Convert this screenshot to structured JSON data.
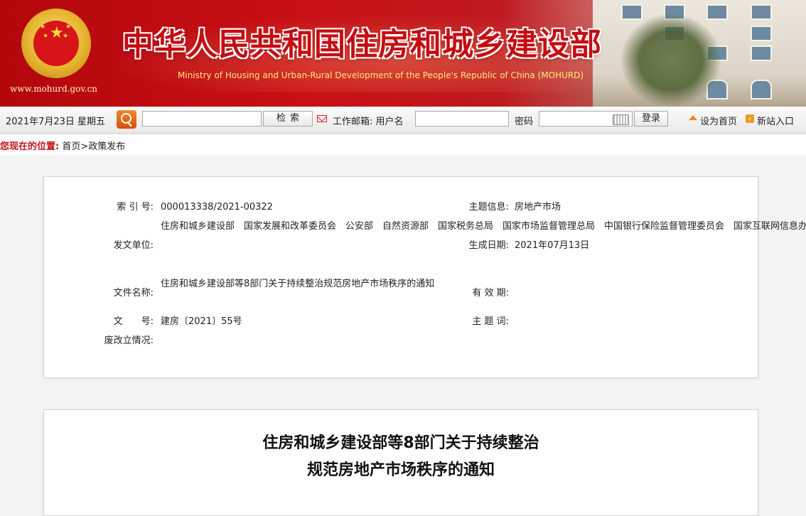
{
  "banner": {
    "site_url": "www.mohurd.gov.cn",
    "title_cn": "中华人民共和国住房和城乡建设部",
    "title_en": "Ministry of Housing and Urban-Rural Development of the People's Republic of China (MOHURD)"
  },
  "toolbar": {
    "date": "2021年7月23日 星期五",
    "search_value": "",
    "search_button": "检索",
    "mail_label": "工作邮箱: 用户名",
    "username_value": "",
    "password_label": "密码",
    "password_value": "",
    "login_button": "登录",
    "set_home": "设为首页",
    "new_site": "新站入口"
  },
  "breadcrumb": {
    "label": "您现在的位置:",
    "path": "首页>政策发布"
  },
  "info": {
    "index_label": "索 引 号:",
    "index_value": "000013338/2021-00322",
    "topic_label": "主题信息:",
    "topic_value": "房地产市场",
    "issuer_label": "发文单位:",
    "issuer_value": "住房和城乡建设部　国家发展和改革委员会　公安部　自然资源部　国家税务总局　国家市场监督管理总局　中国银行保险监督管理委员会　国家互联网信息办公室",
    "date_label": "生成日期:",
    "date_value": "2021年07月13日",
    "filename_label": "文件名称:",
    "filename_value": "住房和城乡建设部等8部门关于持续整治规范房地产市场秩序的通知",
    "valid_label": "有 效 期:",
    "valid_value": "",
    "docno_label": "文　　号:",
    "docno_value": "建房〔2021〕55号",
    "keywords_label": "主 题 词:",
    "keywords_value": "",
    "status_label": "废改立情况:",
    "status_value": ""
  },
  "document": {
    "title_line1": "住房和城乡建设部等8部门关于持续整治",
    "title_line2": "规范房地产市场秩序的通知"
  },
  "colors": {
    "brand_red": "#c60d12",
    "accent_orange": "#e06a12"
  },
  "icons": [
    "national-emblem-icon",
    "search-icon",
    "mail-icon",
    "keyboard-icon",
    "home-icon",
    "rss-icon"
  ]
}
